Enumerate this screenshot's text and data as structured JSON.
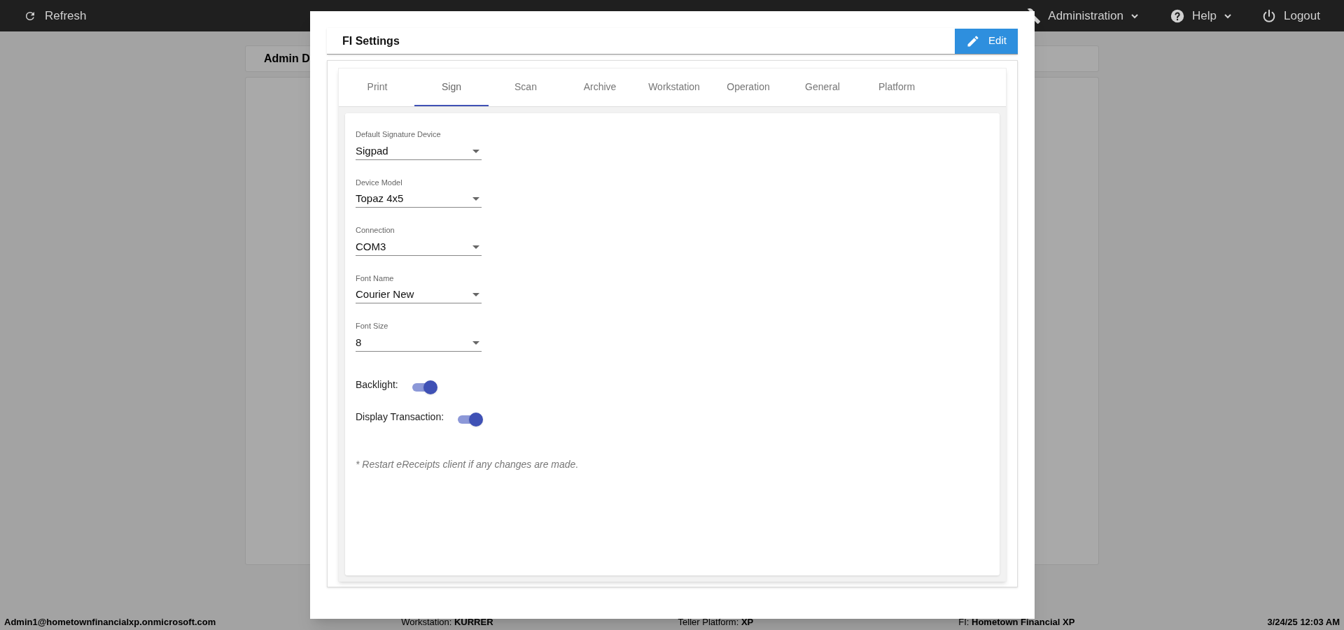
{
  "top_bar": {
    "refresh": "Refresh",
    "menus": [
      {
        "label": "Administration",
        "kind": "tools"
      },
      {
        "label": "Help",
        "kind": "help"
      }
    ],
    "logout": "Logout"
  },
  "background_card": {
    "title": "Admin D"
  },
  "modal": {
    "title": "FI Settings",
    "edit_button": "Edit",
    "tabs": [
      {
        "label": "Print",
        "selected": false
      },
      {
        "label": "Sign",
        "selected": true
      },
      {
        "label": "Scan",
        "selected": false
      },
      {
        "label": "Archive",
        "selected": false
      },
      {
        "label": "Workstation",
        "selected": false
      },
      {
        "label": "Operation",
        "selected": false
      },
      {
        "label": "General",
        "selected": false
      },
      {
        "label": "Platform",
        "selected": false
      }
    ],
    "fields": [
      {
        "label": "Default Signature Device",
        "value": "Sigpad"
      },
      {
        "label": "Device Model",
        "value": "Topaz 4x5"
      },
      {
        "label": "Connection",
        "value": "COM3"
      },
      {
        "label": "Font Name",
        "value": "Courier New"
      },
      {
        "label": "Font Size",
        "value": "8"
      }
    ],
    "toggles": [
      {
        "label": "Backlight:",
        "on": true
      },
      {
        "label": "Display Transaction:",
        "on": true
      }
    ],
    "note": "* Restart eReceipts client if any changes are made."
  },
  "status_bar": {
    "user": "Admin1@hometownfinancialxp.onmicrosoft.com",
    "items": [
      {
        "label": "Workstation:",
        "value": "KURRER"
      },
      {
        "label": "Teller Platform:",
        "value": "XP"
      },
      {
        "label": "FI:",
        "value": "Hometown Financial XP"
      }
    ],
    "datetime": "3/24/25 12:03 AM"
  }
}
